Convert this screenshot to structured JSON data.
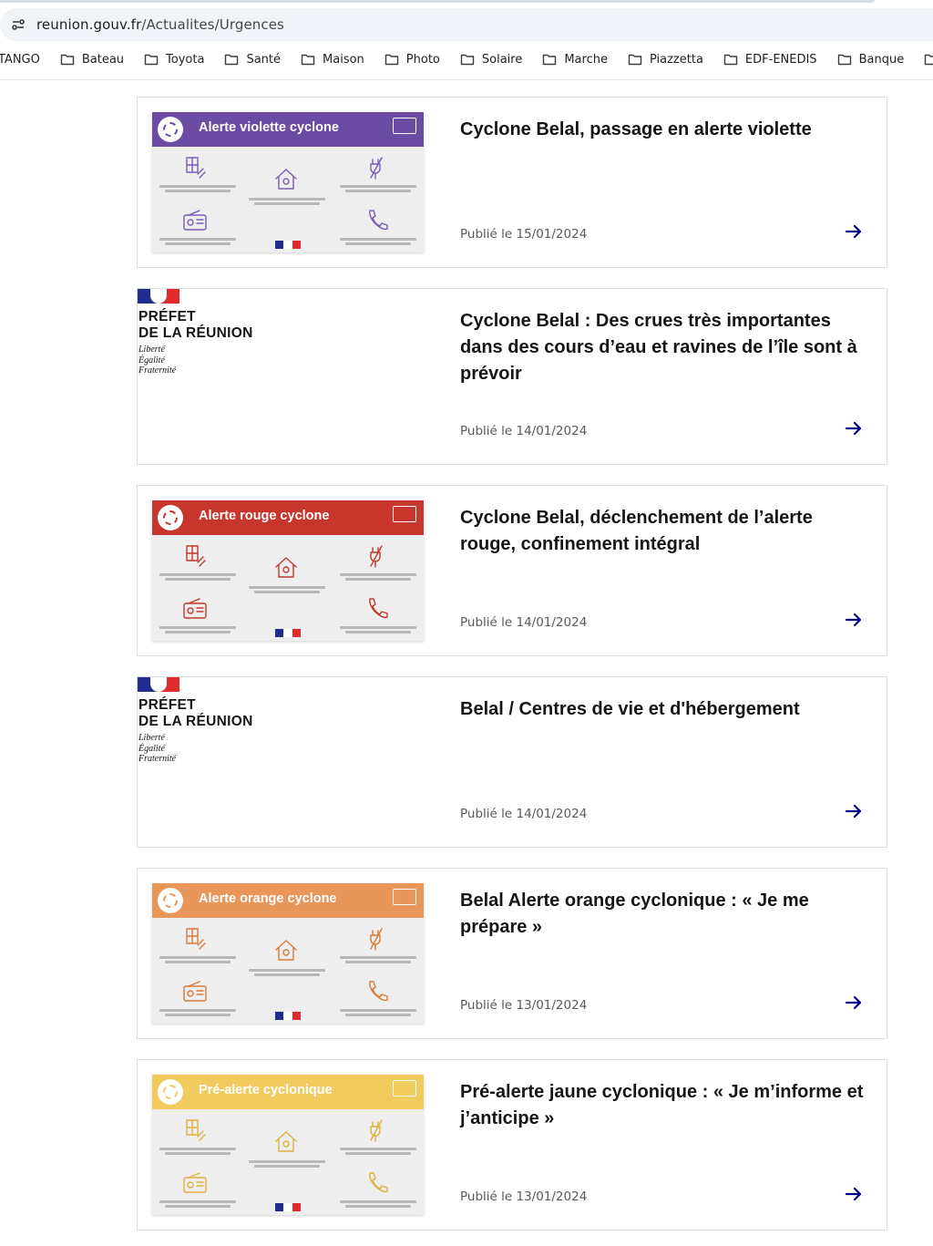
{
  "browser": {
    "url_host": "reunion.gouv.fr",
    "url_path": "/Actualites/Urgences",
    "bookmarks": [
      {
        "label": "TANGO"
      },
      {
        "label": "Bateau"
      },
      {
        "label": "Toyota"
      },
      {
        "label": "Santé"
      },
      {
        "label": "Maison"
      },
      {
        "label": "Photo"
      },
      {
        "label": "Solaire"
      },
      {
        "label": "Marche"
      },
      {
        "label": "Piazzetta"
      },
      {
        "label": "EDF-ENEDIS"
      },
      {
        "label": "Banque"
      }
    ]
  },
  "logo": {
    "line1": "PRÉFET",
    "line2": "DE LA RÉUNION",
    "motto1": "Liberté",
    "motto2": "Égalité",
    "motto3": "Fraternité"
  },
  "articles": [
    {
      "title": "Cyclone Belal, passage en alerte violette",
      "date": "Publié le 15/01/2024",
      "thumbnail": {
        "type": "alert",
        "band_title": "Alerte violette cyclone",
        "band_color": "#6b4ba3",
        "icon_color": "#7a5bb5"
      }
    },
    {
      "title": "Cyclone Belal : Des crues très importantes dans des cours d’eau et ravines de l’île sont à prévoir",
      "date": "Publié le 14/01/2024",
      "thumbnail": {
        "type": "logo"
      }
    },
    {
      "title": "Cyclone Belal, déclenchement de l’alerte rouge, confinement intégral",
      "date": "Publié le 14/01/2024",
      "thumbnail": {
        "type": "alert",
        "band_title": "Alerte rouge cyclone",
        "band_color": "#c8352d",
        "icon_color": "#c0392b"
      }
    },
    {
      "title": "Belal / Centres de vie et d'hébergement",
      "date": "Publié le 14/01/2024",
      "thumbnail": {
        "type": "logo"
      }
    },
    {
      "title": "Belal Alerte orange cyclonique : « Je me prépare »",
      "date": "Publié le 13/01/2024",
      "thumbnail": {
        "type": "alert",
        "band_title": "Alerte orange cyclone",
        "band_color": "#e8965a",
        "icon_color": "#d9793a"
      }
    },
    {
      "title": "Pré-alerte jaune cyclonique : « Je m’informe et j’anticipe »",
      "date": "Publié le 13/01/2024",
      "thumbnail": {
        "type": "alert",
        "band_title": "Pré-alerte cyclonique",
        "band_color": "#f1cb5e",
        "icon_color": "#e0b13e"
      }
    }
  ],
  "colors": {
    "arrow": "#000091",
    "card_border": "#dddddd"
  },
  "icons": {
    "article_link": "arrow-right-icon",
    "bookmark": "folder-icon",
    "site_info": "tune-icon"
  }
}
